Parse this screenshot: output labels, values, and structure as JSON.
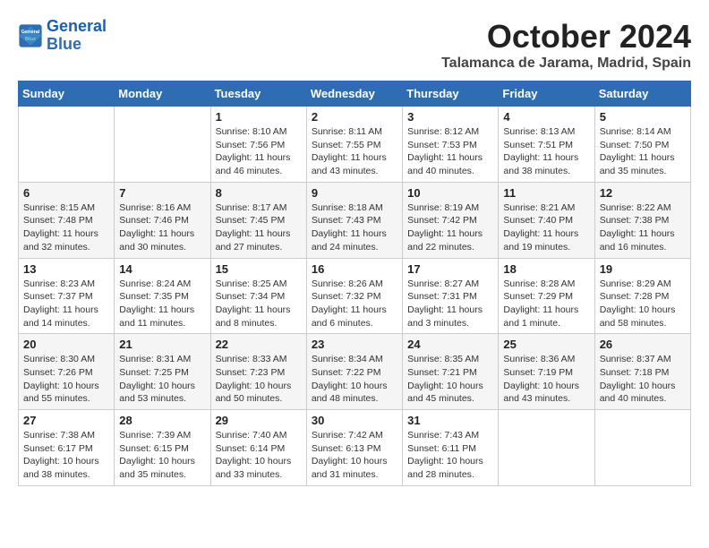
{
  "header": {
    "logo_general": "General",
    "logo_blue": "Blue",
    "month": "October 2024",
    "location": "Talamanca de Jarama, Madrid, Spain"
  },
  "weekdays": [
    "Sunday",
    "Monday",
    "Tuesday",
    "Wednesday",
    "Thursday",
    "Friday",
    "Saturday"
  ],
  "weeks": [
    [
      {
        "day": "",
        "detail": ""
      },
      {
        "day": "",
        "detail": ""
      },
      {
        "day": "1",
        "detail": "Sunrise: 8:10 AM\nSunset: 7:56 PM\nDaylight: 11 hours and 46 minutes."
      },
      {
        "day": "2",
        "detail": "Sunrise: 8:11 AM\nSunset: 7:55 PM\nDaylight: 11 hours and 43 minutes."
      },
      {
        "day": "3",
        "detail": "Sunrise: 8:12 AM\nSunset: 7:53 PM\nDaylight: 11 hours and 40 minutes."
      },
      {
        "day": "4",
        "detail": "Sunrise: 8:13 AM\nSunset: 7:51 PM\nDaylight: 11 hours and 38 minutes."
      },
      {
        "day": "5",
        "detail": "Sunrise: 8:14 AM\nSunset: 7:50 PM\nDaylight: 11 hours and 35 minutes."
      }
    ],
    [
      {
        "day": "6",
        "detail": "Sunrise: 8:15 AM\nSunset: 7:48 PM\nDaylight: 11 hours and 32 minutes."
      },
      {
        "day": "7",
        "detail": "Sunrise: 8:16 AM\nSunset: 7:46 PM\nDaylight: 11 hours and 30 minutes."
      },
      {
        "day": "8",
        "detail": "Sunrise: 8:17 AM\nSunset: 7:45 PM\nDaylight: 11 hours and 27 minutes."
      },
      {
        "day": "9",
        "detail": "Sunrise: 8:18 AM\nSunset: 7:43 PM\nDaylight: 11 hours and 24 minutes."
      },
      {
        "day": "10",
        "detail": "Sunrise: 8:19 AM\nSunset: 7:42 PM\nDaylight: 11 hours and 22 minutes."
      },
      {
        "day": "11",
        "detail": "Sunrise: 8:21 AM\nSunset: 7:40 PM\nDaylight: 11 hours and 19 minutes."
      },
      {
        "day": "12",
        "detail": "Sunrise: 8:22 AM\nSunset: 7:38 PM\nDaylight: 11 hours and 16 minutes."
      }
    ],
    [
      {
        "day": "13",
        "detail": "Sunrise: 8:23 AM\nSunset: 7:37 PM\nDaylight: 11 hours and 14 minutes."
      },
      {
        "day": "14",
        "detail": "Sunrise: 8:24 AM\nSunset: 7:35 PM\nDaylight: 11 hours and 11 minutes."
      },
      {
        "day": "15",
        "detail": "Sunrise: 8:25 AM\nSunset: 7:34 PM\nDaylight: 11 hours and 8 minutes."
      },
      {
        "day": "16",
        "detail": "Sunrise: 8:26 AM\nSunset: 7:32 PM\nDaylight: 11 hours and 6 minutes."
      },
      {
        "day": "17",
        "detail": "Sunrise: 8:27 AM\nSunset: 7:31 PM\nDaylight: 11 hours and 3 minutes."
      },
      {
        "day": "18",
        "detail": "Sunrise: 8:28 AM\nSunset: 7:29 PM\nDaylight: 11 hours and 1 minute."
      },
      {
        "day": "19",
        "detail": "Sunrise: 8:29 AM\nSunset: 7:28 PM\nDaylight: 10 hours and 58 minutes."
      }
    ],
    [
      {
        "day": "20",
        "detail": "Sunrise: 8:30 AM\nSunset: 7:26 PM\nDaylight: 10 hours and 55 minutes."
      },
      {
        "day": "21",
        "detail": "Sunrise: 8:31 AM\nSunset: 7:25 PM\nDaylight: 10 hours and 53 minutes."
      },
      {
        "day": "22",
        "detail": "Sunrise: 8:33 AM\nSunset: 7:23 PM\nDaylight: 10 hours and 50 minutes."
      },
      {
        "day": "23",
        "detail": "Sunrise: 8:34 AM\nSunset: 7:22 PM\nDaylight: 10 hours and 48 minutes."
      },
      {
        "day": "24",
        "detail": "Sunrise: 8:35 AM\nSunset: 7:21 PM\nDaylight: 10 hours and 45 minutes."
      },
      {
        "day": "25",
        "detail": "Sunrise: 8:36 AM\nSunset: 7:19 PM\nDaylight: 10 hours and 43 minutes."
      },
      {
        "day": "26",
        "detail": "Sunrise: 8:37 AM\nSunset: 7:18 PM\nDaylight: 10 hours and 40 minutes."
      }
    ],
    [
      {
        "day": "27",
        "detail": "Sunrise: 7:38 AM\nSunset: 6:17 PM\nDaylight: 10 hours and 38 minutes."
      },
      {
        "day": "28",
        "detail": "Sunrise: 7:39 AM\nSunset: 6:15 PM\nDaylight: 10 hours and 35 minutes."
      },
      {
        "day": "29",
        "detail": "Sunrise: 7:40 AM\nSunset: 6:14 PM\nDaylight: 10 hours and 33 minutes."
      },
      {
        "day": "30",
        "detail": "Sunrise: 7:42 AM\nSunset: 6:13 PM\nDaylight: 10 hours and 31 minutes."
      },
      {
        "day": "31",
        "detail": "Sunrise: 7:43 AM\nSunset: 6:11 PM\nDaylight: 10 hours and 28 minutes."
      },
      {
        "day": "",
        "detail": ""
      },
      {
        "day": "",
        "detail": ""
      }
    ]
  ]
}
